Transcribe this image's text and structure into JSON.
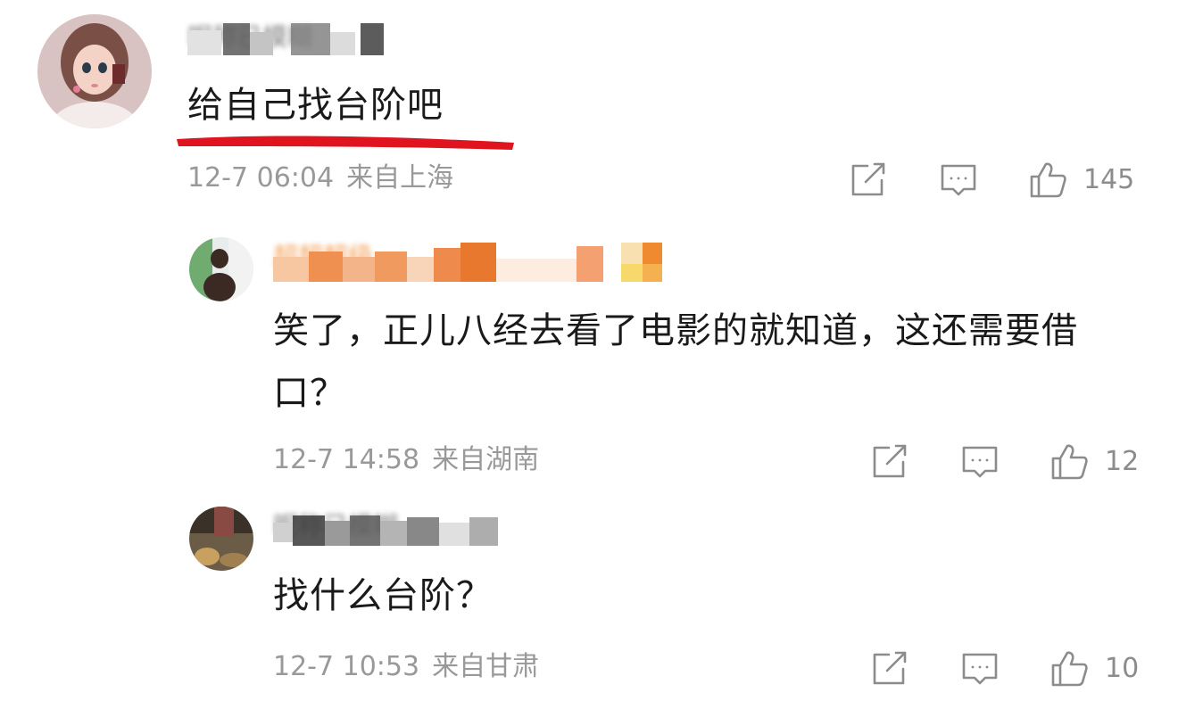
{
  "comments": [
    {
      "username": "昵称已模糊",
      "text": "给自己找台阶吧",
      "date": "12-7 06:04",
      "location": "来自上海",
      "likes": "145",
      "highlighted": true
    },
    {
      "username": "超超超级",
      "text": "笑了，正儿八经去看了电影的就知道，这还需要借口？",
      "date": "12-7 14:58",
      "location": "来自湖南",
      "likes": "12"
    },
    {
      "username": "昵称已模糊",
      "text": "找什么台阶？",
      "date": "12-7 10:53",
      "location": "来自甘肃",
      "likes": "10"
    }
  ],
  "colors": {
    "text": "#1a1a1a",
    "meta": "#999999",
    "icon": "#8c8c8c",
    "underline": "#e0141e",
    "username_orange": "#f07d1a"
  },
  "icons": {
    "share": "share-icon",
    "comment": "comment-icon",
    "like": "thumbs-up-icon"
  }
}
